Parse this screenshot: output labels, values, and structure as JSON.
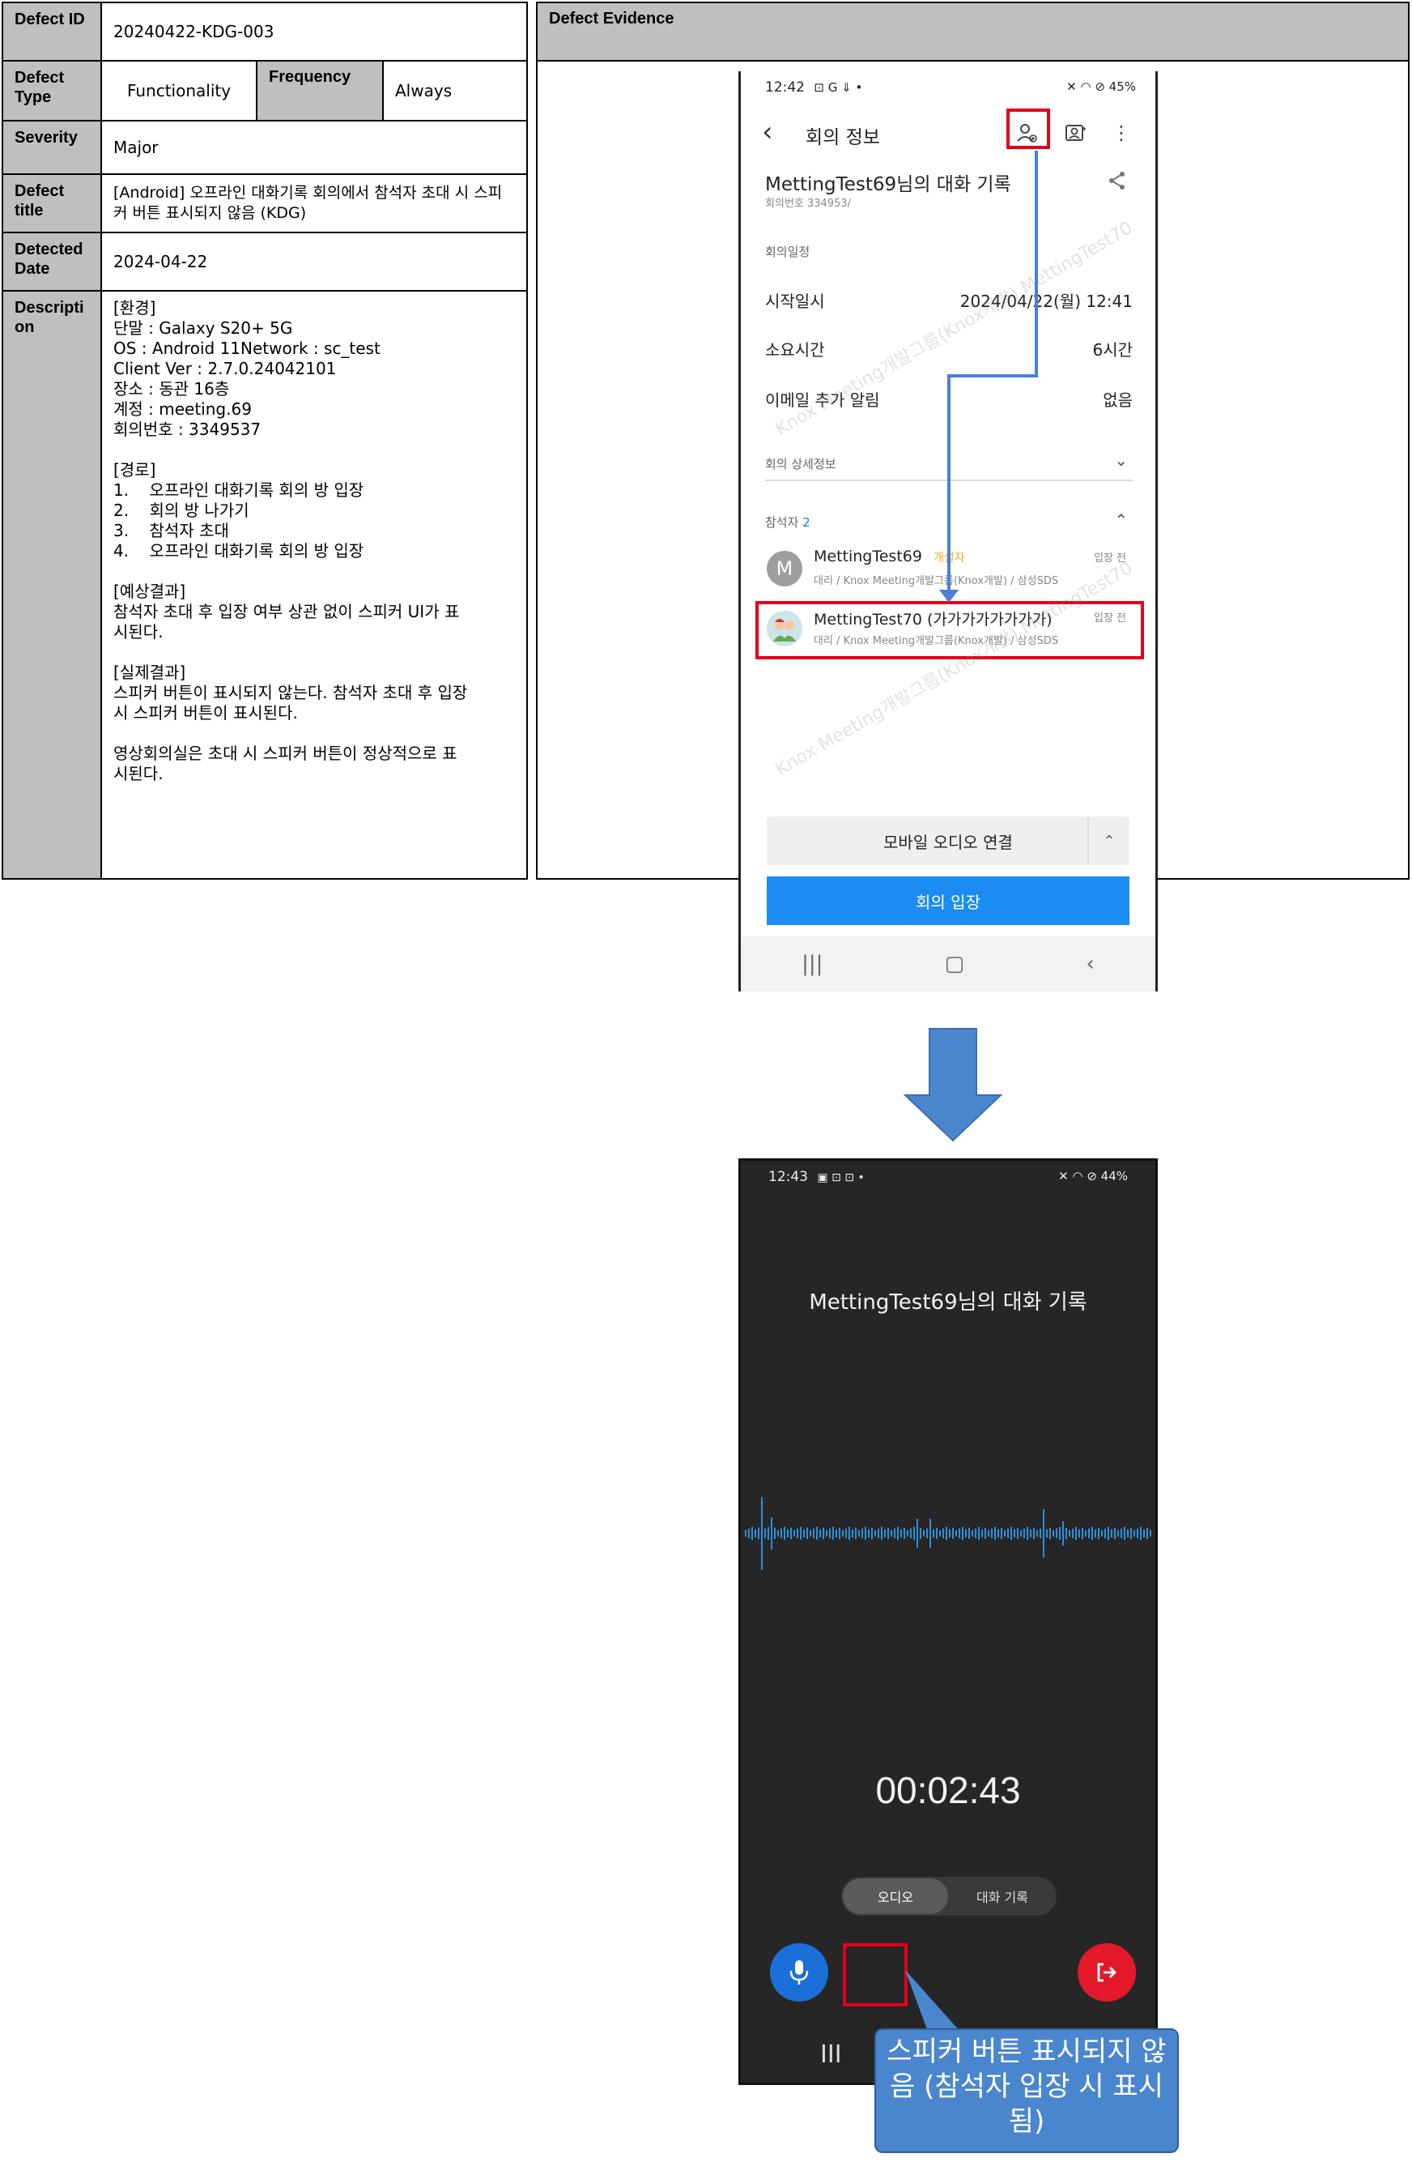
{
  "table": {
    "defect_id_label": "Defect ID",
    "defect_id": "20240422-KDG-003",
    "defect_type_label": "Defect Type",
    "defect_type": "Functionality",
    "frequency_label": "Frequency",
    "frequency": "Always",
    "severity_label": "Severity",
    "severity": "Major",
    "title_label": "Defect title",
    "title": "[Android] 오프라인 대화기록 회의에서 참석자 초대 시 스피커 버튼 표시되지 않음 (KDG)",
    "date_label": "Detected Date",
    "date": "2024-04-22",
    "description_label": "Descripti on",
    "description": "[환경]\n단말 : Galaxy S20+ 5G\nOS : Android 11Network : sc_test\nClient Ver : 2.7.0.24042101\n장소 : 동관 16층\n계정 : meeting.69\n회의번호 : 3349537\n\n[경로]\n1.    오프라인 대화기록 회의 방 입장\n2.    회의 방 나가기\n3.    참석자 초대\n4.    오프라인 대화기록 회의 방 입장\n\n[예상결과]\n참석자 초대 후 입장 여부 상관 없이 스피커 UI가 표\n시된다.\n\n[실제결과]\n스피커 버튼이 표시되지 않는다. 참석자 초대 후 입장\n시 스피커 버튼이 표시된다.\n\n영상회의실은 초대 시 스피커 버튼이 정상적으로 표\n시된다."
  },
  "evidence": {
    "header": "Defect Evidence"
  },
  "phone1": {
    "status_time": "12:42",
    "status_glyphs": "⊡ G ⇓ •",
    "status_right": "✕ ◠ ⊘ 45%",
    "battery": "45%",
    "header_title": "회의 정보",
    "meeting_title": "MettingTest69님의 대화 기록",
    "meeting_no": "회의번호 334953/",
    "schedule_section": "회의일정",
    "start_label": "시작일시",
    "start_value": "2024/04/22(월) 12:41",
    "duration_label": "소요시간",
    "duration_value": "6시간",
    "email_label": "이메일 추가 알림",
    "email_value": "없음",
    "detail_section": "회의 상세정보",
    "participants_label": "참석자",
    "participants_count": "2",
    "participants": [
      {
        "initial": "M",
        "name": "MettingTest69",
        "host": "개설자",
        "org": "대리 / Knox Meeting개발그룹(Knox개발) / 삼성SDS",
        "status": "입장 전"
      },
      {
        "initial": "",
        "name": "MettingTest70 (가가가가가가가가)",
        "host": "",
        "org": "대리 / Knox Meeting개발그룹(Knox개발) / 삼성SDS",
        "status": "입장 전"
      }
    ],
    "mobile_audio": "모바일 오디오 연결",
    "join_button": "회의 입장",
    "watermark": "Knox Meeting개발그룹(Knox개발) MettingTest70"
  },
  "phone2": {
    "status_time": "12:43",
    "status_glyphs": "▣ ⊡ ⊡ •",
    "status_right": "✕ ◠ ⊘ 44%",
    "battery": "44%",
    "title": "MettingTest69님의 대화 기록",
    "timer": "00:02:43",
    "tab_audio": "오디오",
    "tab_transcript": "대화 기록",
    "nav_recent": "III"
  },
  "callout": {
    "text": "스피커 버튼 표시되지 않음 (참석자 입장 시 표시됨)"
  },
  "colors": {
    "label_bg": "#bfbfbf",
    "highlight": "#e3001b",
    "connector": "#4a7fd4",
    "join_blue": "#1a8cf4",
    "callout_blue": "#4a86cd",
    "dark_bg": "#262626"
  }
}
